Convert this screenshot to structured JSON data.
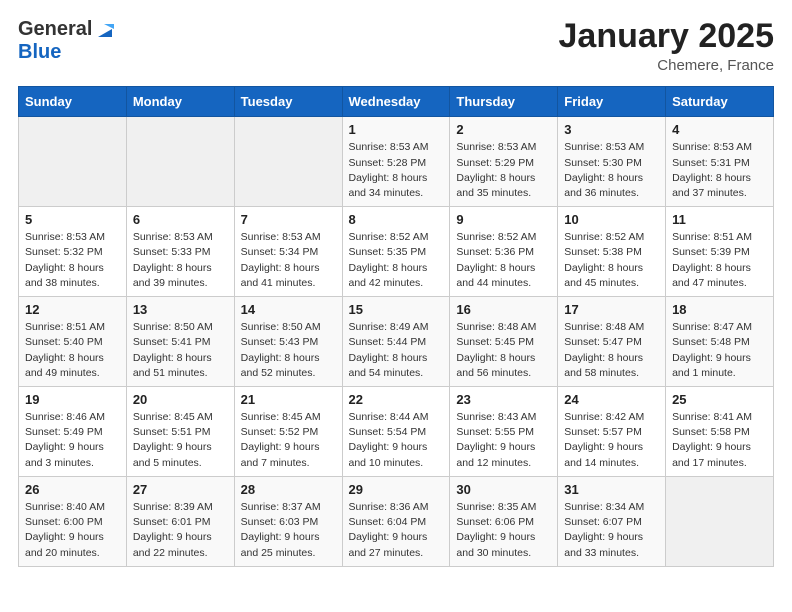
{
  "header": {
    "logo_general": "General",
    "logo_blue": "Blue",
    "month_title": "January 2025",
    "location": "Chemere, France"
  },
  "days_of_week": [
    "Sunday",
    "Monday",
    "Tuesday",
    "Wednesday",
    "Thursday",
    "Friday",
    "Saturday"
  ],
  "weeks": [
    [
      {
        "day": "",
        "info": ""
      },
      {
        "day": "",
        "info": ""
      },
      {
        "day": "",
        "info": ""
      },
      {
        "day": "1",
        "info": "Sunrise: 8:53 AM\nSunset: 5:28 PM\nDaylight: 8 hours\nand 34 minutes."
      },
      {
        "day": "2",
        "info": "Sunrise: 8:53 AM\nSunset: 5:29 PM\nDaylight: 8 hours\nand 35 minutes."
      },
      {
        "day": "3",
        "info": "Sunrise: 8:53 AM\nSunset: 5:30 PM\nDaylight: 8 hours\nand 36 minutes."
      },
      {
        "day": "4",
        "info": "Sunrise: 8:53 AM\nSunset: 5:31 PM\nDaylight: 8 hours\nand 37 minutes."
      }
    ],
    [
      {
        "day": "5",
        "info": "Sunrise: 8:53 AM\nSunset: 5:32 PM\nDaylight: 8 hours\nand 38 minutes."
      },
      {
        "day": "6",
        "info": "Sunrise: 8:53 AM\nSunset: 5:33 PM\nDaylight: 8 hours\nand 39 minutes."
      },
      {
        "day": "7",
        "info": "Sunrise: 8:53 AM\nSunset: 5:34 PM\nDaylight: 8 hours\nand 41 minutes."
      },
      {
        "day": "8",
        "info": "Sunrise: 8:52 AM\nSunset: 5:35 PM\nDaylight: 8 hours\nand 42 minutes."
      },
      {
        "day": "9",
        "info": "Sunrise: 8:52 AM\nSunset: 5:36 PM\nDaylight: 8 hours\nand 44 minutes."
      },
      {
        "day": "10",
        "info": "Sunrise: 8:52 AM\nSunset: 5:38 PM\nDaylight: 8 hours\nand 45 minutes."
      },
      {
        "day": "11",
        "info": "Sunrise: 8:51 AM\nSunset: 5:39 PM\nDaylight: 8 hours\nand 47 minutes."
      }
    ],
    [
      {
        "day": "12",
        "info": "Sunrise: 8:51 AM\nSunset: 5:40 PM\nDaylight: 8 hours\nand 49 minutes."
      },
      {
        "day": "13",
        "info": "Sunrise: 8:50 AM\nSunset: 5:41 PM\nDaylight: 8 hours\nand 51 minutes."
      },
      {
        "day": "14",
        "info": "Sunrise: 8:50 AM\nSunset: 5:43 PM\nDaylight: 8 hours\nand 52 minutes."
      },
      {
        "day": "15",
        "info": "Sunrise: 8:49 AM\nSunset: 5:44 PM\nDaylight: 8 hours\nand 54 minutes."
      },
      {
        "day": "16",
        "info": "Sunrise: 8:48 AM\nSunset: 5:45 PM\nDaylight: 8 hours\nand 56 minutes."
      },
      {
        "day": "17",
        "info": "Sunrise: 8:48 AM\nSunset: 5:47 PM\nDaylight: 8 hours\nand 58 minutes."
      },
      {
        "day": "18",
        "info": "Sunrise: 8:47 AM\nSunset: 5:48 PM\nDaylight: 9 hours\nand 1 minute."
      }
    ],
    [
      {
        "day": "19",
        "info": "Sunrise: 8:46 AM\nSunset: 5:49 PM\nDaylight: 9 hours\nand 3 minutes."
      },
      {
        "day": "20",
        "info": "Sunrise: 8:45 AM\nSunset: 5:51 PM\nDaylight: 9 hours\nand 5 minutes."
      },
      {
        "day": "21",
        "info": "Sunrise: 8:45 AM\nSunset: 5:52 PM\nDaylight: 9 hours\nand 7 minutes."
      },
      {
        "day": "22",
        "info": "Sunrise: 8:44 AM\nSunset: 5:54 PM\nDaylight: 9 hours\nand 10 minutes."
      },
      {
        "day": "23",
        "info": "Sunrise: 8:43 AM\nSunset: 5:55 PM\nDaylight: 9 hours\nand 12 minutes."
      },
      {
        "day": "24",
        "info": "Sunrise: 8:42 AM\nSunset: 5:57 PM\nDaylight: 9 hours\nand 14 minutes."
      },
      {
        "day": "25",
        "info": "Sunrise: 8:41 AM\nSunset: 5:58 PM\nDaylight: 9 hours\nand 17 minutes."
      }
    ],
    [
      {
        "day": "26",
        "info": "Sunrise: 8:40 AM\nSunset: 6:00 PM\nDaylight: 9 hours\nand 20 minutes."
      },
      {
        "day": "27",
        "info": "Sunrise: 8:39 AM\nSunset: 6:01 PM\nDaylight: 9 hours\nand 22 minutes."
      },
      {
        "day": "28",
        "info": "Sunrise: 8:37 AM\nSunset: 6:03 PM\nDaylight: 9 hours\nand 25 minutes."
      },
      {
        "day": "29",
        "info": "Sunrise: 8:36 AM\nSunset: 6:04 PM\nDaylight: 9 hours\nand 27 minutes."
      },
      {
        "day": "30",
        "info": "Sunrise: 8:35 AM\nSunset: 6:06 PM\nDaylight: 9 hours\nand 30 minutes."
      },
      {
        "day": "31",
        "info": "Sunrise: 8:34 AM\nSunset: 6:07 PM\nDaylight: 9 hours\nand 33 minutes."
      },
      {
        "day": "",
        "info": ""
      }
    ]
  ]
}
